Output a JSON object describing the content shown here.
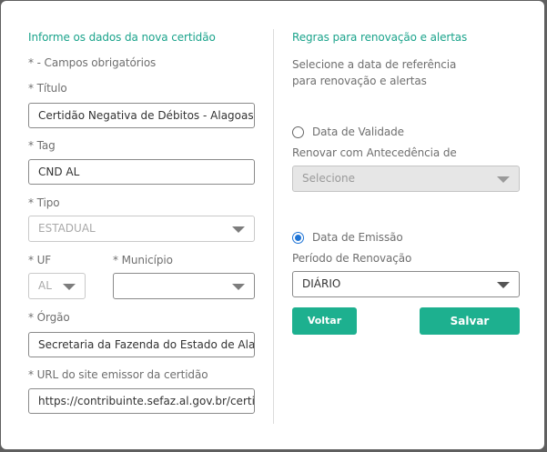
{
  "left": {
    "section_title": "Informe os dados da nova certidão",
    "required_note": "* - Campos obrigatórios",
    "titulo_label": "* Título",
    "titulo_value": "Certidão Negativa de Débitos - Alagoas (A",
    "tag_label": "* Tag",
    "tag_value": "CND AL",
    "tipo_label": "* Tipo",
    "tipo_value": "ESTADUAL",
    "uf_label": "* UF",
    "uf_value": "AL",
    "municipio_label": "* Município",
    "municipio_value": "",
    "orgao_label": "* Órgão",
    "orgao_value": "Secretaria da Fazenda do Estado de Alag",
    "url_label": "* URL do site emissor da certidão",
    "url_value": "https://contribuinte.sefaz.al.gov.br/certic"
  },
  "right": {
    "section_title": "Regras para renovação e alertas",
    "description": "Selecione a data de referência para renovação e alertas",
    "radio_validade_label": "Data de Validade",
    "antecedencia_label": "Renovar com Antecedência de",
    "antecedencia_value": "Selecione",
    "radio_emissao_label": "Data de Emissão",
    "periodo_label": "Período de Renovação",
    "periodo_value": "DIÁRIO",
    "voltar_label": "Voltar",
    "salvar_label": "Salvar"
  },
  "colors": {
    "accent": "#1aa38b",
    "button": "#1db08f",
    "radio": "#1e74d6"
  }
}
